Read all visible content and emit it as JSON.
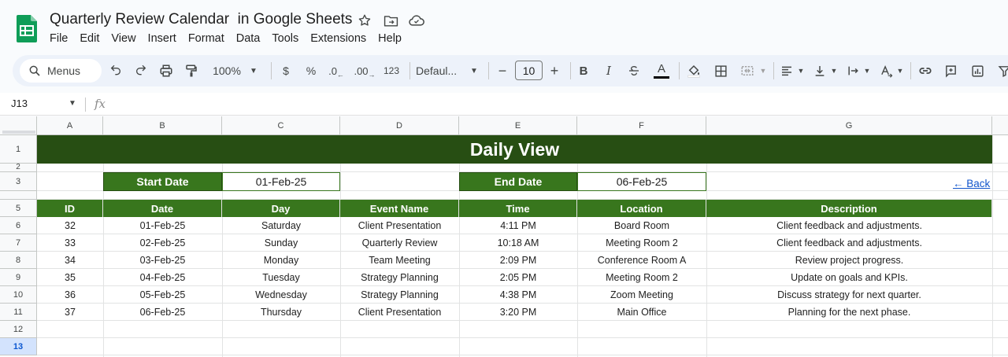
{
  "app": {
    "title": "Quarterly Review Calendar  in Google Sheets",
    "menu": [
      "File",
      "Edit",
      "View",
      "Insert",
      "Format",
      "Data",
      "Tools",
      "Extensions",
      "Help"
    ]
  },
  "toolbar": {
    "menus_label": "Menus",
    "zoom": "100%",
    "currency": "$",
    "percent": "%",
    "dec_decrease": ".0",
    "dec_increase": ".00",
    "number_format": "123",
    "font": "Defaul...",
    "font_size": "10",
    "bold": "B",
    "italic": "I",
    "text_color_letter": "A",
    "minus": "−",
    "plus": "+"
  },
  "formula_bar": {
    "name_box": "J13",
    "fx": "fx",
    "content": ""
  },
  "columns": [
    "A",
    "B",
    "C",
    "D",
    "E",
    "F",
    "G"
  ],
  "rows": [
    "1",
    "2",
    "3",
    "",
    "5",
    "6",
    "7",
    "8",
    "9",
    "10",
    "11",
    "12",
    "13"
  ],
  "selected_row": "13",
  "sheet": {
    "banner": "Daily View",
    "start_label": "Start Date",
    "start_value": "01-Feb-25",
    "end_label": "End Date",
    "end_value": "06-Feb-25",
    "back_link": "← Back",
    "headers": [
      "ID",
      "Date",
      "Day",
      "Event Name",
      "Time",
      "Location",
      "Description"
    ],
    "records": [
      [
        "32",
        "01-Feb-25",
        "Saturday",
        "Client Presentation",
        "4:11 PM",
        "Board Room",
        "Client feedback and adjustments."
      ],
      [
        "33",
        "02-Feb-25",
        "Sunday",
        "Quarterly Review",
        "10:18 AM",
        "Meeting Room 2",
        "Client feedback and adjustments."
      ],
      [
        "34",
        "03-Feb-25",
        "Monday",
        "Team Meeting",
        "2:09 PM",
        "Conference Room A",
        "Review project progress."
      ],
      [
        "35",
        "04-Feb-25",
        "Tuesday",
        "Strategy Planning",
        "2:05 PM",
        "Meeting Room 2",
        "Update on goals and KPIs."
      ],
      [
        "36",
        "05-Feb-25",
        "Wednesday",
        "Strategy Planning",
        "4:38 PM",
        "Zoom Meeting",
        "Discuss strategy for next quarter."
      ],
      [
        "37",
        "06-Feb-25",
        "Thursday",
        "Client Presentation",
        "3:20 PM",
        "Main Office",
        "Planning for the next phase."
      ]
    ]
  },
  "colors": {
    "banner_bg": "#274e13",
    "header_bg": "#38761d",
    "link": "#1155cc",
    "sheets_green": "#0f9d58"
  }
}
